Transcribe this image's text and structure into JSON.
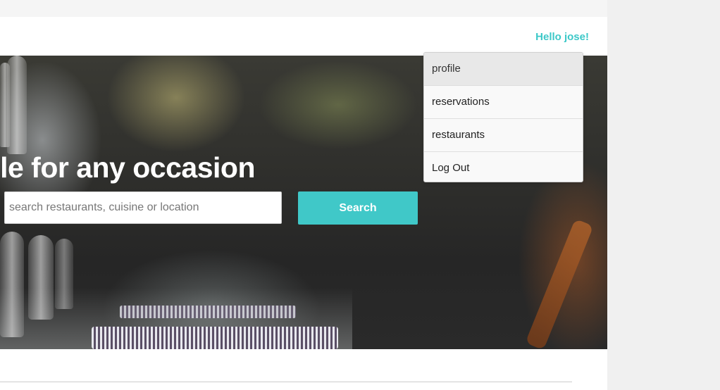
{
  "header": {
    "greeting": "Hello jose!"
  },
  "hero": {
    "headline": "Find a table for any occasion",
    "search": {
      "placeholder": "search restaurants, cuisine or location",
      "value": "",
      "button_label": "Search"
    }
  },
  "user_menu": {
    "items": [
      {
        "label": "profile"
      },
      {
        "label": "reservations"
      },
      {
        "label": "restaurants"
      },
      {
        "label": "Log Out"
      }
    ]
  },
  "colors": {
    "accent": "#40c8c8",
    "greeting": "#3cc8c8"
  }
}
